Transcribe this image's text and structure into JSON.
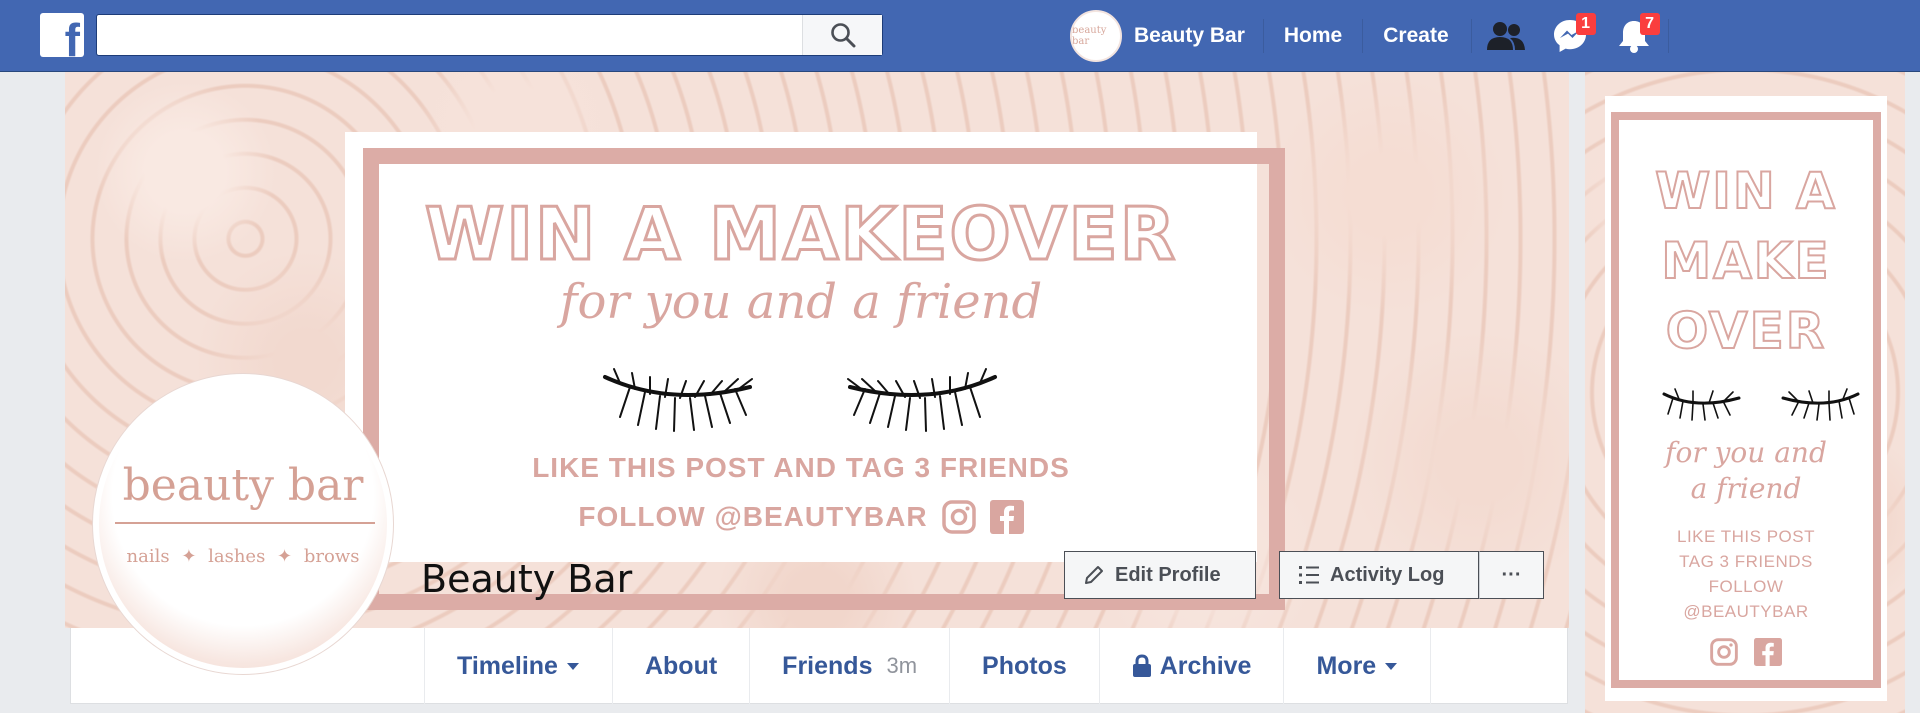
{
  "topbar": {
    "logo_letter": "f",
    "search_placeholder": "",
    "profile_avatar_text": "beauty bar",
    "profile_name": "Beauty Bar",
    "home_label": "Home",
    "create_label": "Create",
    "messages_badge": "1",
    "notifications_badge": "7"
  },
  "cover": {
    "headline": "WIN A MAKEOVER",
    "subline": "for you and a friend",
    "line1": "LIKE THIS POST AND TAG 3 FRIENDS",
    "line2": "FOLLOW @BEAUTYBAR"
  },
  "avatar": {
    "title": "beauty bar",
    "tags": "nails ✦ lashes ✦ brows"
  },
  "page": {
    "name": "Beauty Bar",
    "edit_profile": "Edit Profile",
    "activity_log": "Activity Log",
    "more_dots": "···"
  },
  "tabs": [
    {
      "label": "Timeline"
    },
    {
      "label": "About"
    },
    {
      "label": "Friends",
      "count": "3m"
    },
    {
      "label": "Photos"
    },
    {
      "label": "Archive"
    },
    {
      "label": "More"
    }
  ],
  "side": {
    "title_1": "WIN A",
    "title_2": "MAKE",
    "title_3": "OVER",
    "sub_1": "for you and",
    "sub_2": "a friend",
    "line_1": "LIKE THIS POST",
    "line_2": "TAG 3 FRIENDS",
    "line_3": "FOLLOW",
    "line_4": "@BEAUTYBAR"
  },
  "colors": {
    "fb_blue": "#4267b2",
    "link_blue": "#365899",
    "rose": "#d9a6a0",
    "badge_red": "#fa3e3e"
  }
}
